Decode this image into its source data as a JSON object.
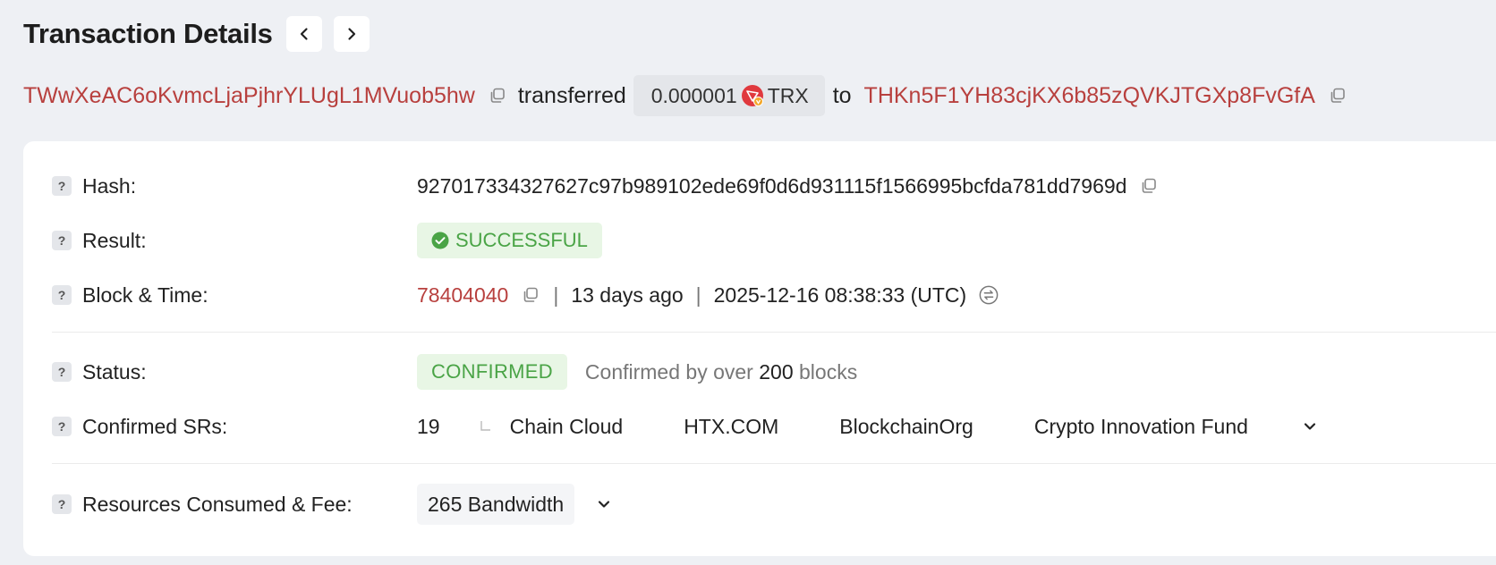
{
  "header": {
    "title": "Transaction Details",
    "prev_icon": "chevron-left-icon",
    "next_icon": "chevron-right-icon"
  },
  "summary": {
    "from_address": "TWwXeAC6oKvmcLjaPjhrYLUgL1MVuob5hw",
    "transferred_word": "transferred",
    "amount": "0.000001",
    "token": "TRX",
    "to_word": "to",
    "to_address": "THKn5F1YH83cjKX6b85zQVKJTGXp8FvGfA"
  },
  "details": {
    "hash": {
      "label": "Hash:",
      "value": "927017334327627c97b989102ede69f0d6d931115f1566995bcfda781dd7969d"
    },
    "result": {
      "label": "Result:",
      "value": "SUCCESSFUL"
    },
    "block_time": {
      "label": "Block & Time:",
      "block": "78404040",
      "sep": "|",
      "ago": "13 days ago",
      "timestamp": "2025-12-16 08:38:33 (UTC)"
    },
    "status": {
      "label": "Status:",
      "value": "CONFIRMED",
      "confirmed_prefix": "Confirmed by over",
      "confirmed_count": "200",
      "confirmed_suffix": "blocks"
    },
    "confirmed_srs": {
      "label": "Confirmed SRs:",
      "count": "19",
      "names": [
        "Chain Cloud",
        "HTX.COM",
        "BlockchainOrg",
        "Crypto Innovation Fund"
      ]
    },
    "resources": {
      "label": "Resources Consumed & Fee:",
      "bandwidth": "265 Bandwidth"
    }
  },
  "colors": {
    "address": "#b8403e",
    "success_bg": "#e8f6e5",
    "success_text": "#4aa446",
    "background": "#eef0f4"
  }
}
